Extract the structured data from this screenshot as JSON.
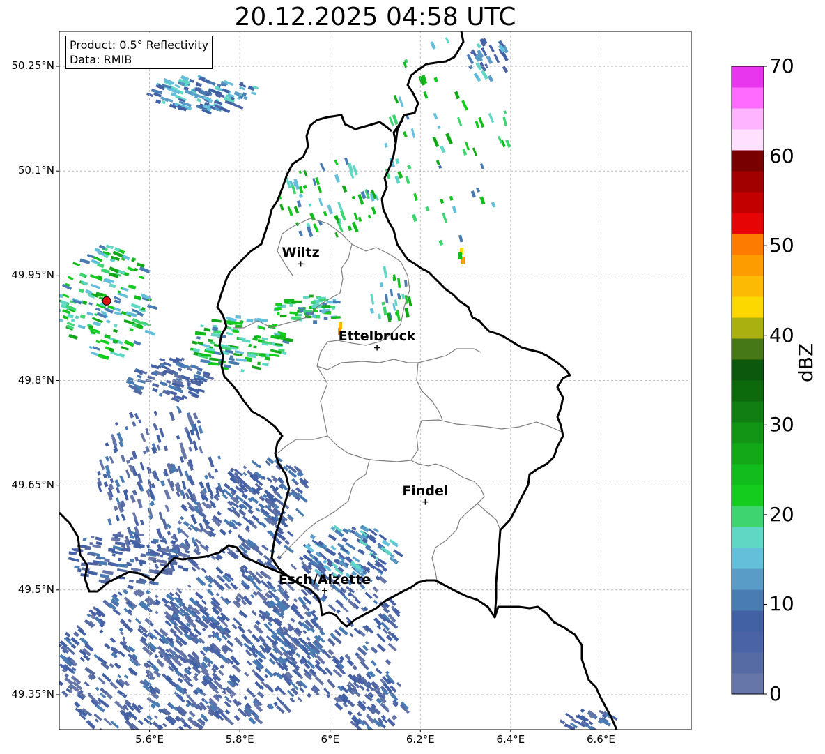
{
  "title": "20.12.2025 04:58 UTC",
  "info": {
    "product": "Product: 0.5° Reflectivity",
    "data": "Data: RMIB"
  },
  "map": {
    "lon_range": [
      5.4,
      6.8
    ],
    "lat_range": [
      49.3,
      50.3
    ],
    "lat_ticks": [
      {
        "value": 50.25,
        "label": "50.25°N"
      },
      {
        "value": 50.1,
        "label": "50.1°N"
      },
      {
        "value": 49.95,
        "label": "49.95°N"
      },
      {
        "value": 49.8,
        "label": "49.8°N"
      },
      {
        "value": 49.65,
        "label": "49.65°N"
      },
      {
        "value": 49.5,
        "label": "49.5°N"
      },
      {
        "value": 49.35,
        "label": "49.35°N"
      }
    ],
    "lon_ticks": [
      {
        "value": 5.6,
        "label": "5.6°E"
      },
      {
        "value": 5.8,
        "label": "5.8°E"
      },
      {
        "value": 6.0,
        "label": "6°E"
      },
      {
        "value": 6.2,
        "label": "6.2°E"
      },
      {
        "value": 6.4,
        "label": "6.4°E"
      },
      {
        "value": 6.6,
        "label": "6.6°E"
      }
    ],
    "gridlines": true,
    "radar_site": {
      "lon": 5.505,
      "lat": 49.914
    },
    "cities": [
      {
        "name": "Wiltz",
        "lon": 5.935,
        "lat": 49.967
      },
      {
        "name": "Ettelbruck",
        "lon": 6.104,
        "lat": 49.847
      },
      {
        "name": "Findel",
        "lon": 6.211,
        "lat": 49.626
      },
      {
        "name": "Esch/Alzette",
        "lon": 5.988,
        "lat": 49.499
      }
    ]
  },
  "colorbar": {
    "label": "dBZ",
    "min": 0,
    "max": 70,
    "ticks": [
      {
        "value": 0,
        "label": "0"
      },
      {
        "value": 10,
        "label": "10"
      },
      {
        "value": 20,
        "label": "20"
      },
      {
        "value": 30,
        "label": "30"
      },
      {
        "value": 40,
        "label": "40"
      },
      {
        "value": 50,
        "label": "50"
      },
      {
        "value": 60,
        "label": "60"
      },
      {
        "value": 70,
        "label": "70"
      }
    ],
    "colors": [
      "#6676a8",
      "#566aa4",
      "#4a62a6",
      "#4260a4",
      "#4a7cb4",
      "#5a9cc8",
      "#64c0da",
      "#60d6c4",
      "#3ed470",
      "#14cc1e",
      "#12bc1c",
      "#12a818",
      "#129414",
      "#107e12",
      "#0c6a0c",
      "#0c580c",
      "#467818",
      "#aab010",
      "#fdd800",
      "#fdba04",
      "#fd9c00",
      "#fd7c00",
      "#e60404",
      "#c20000",
      "#a20000",
      "#780000",
      "#ffe0ff",
      "#ffb4ff",
      "#ff6aff",
      "#e836ee"
    ]
  }
}
